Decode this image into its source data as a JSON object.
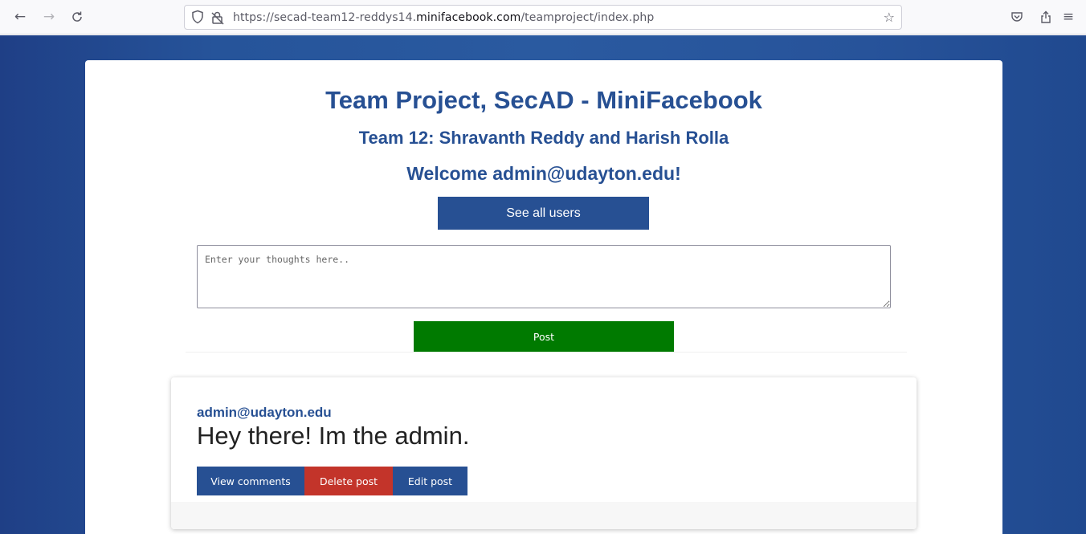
{
  "browser": {
    "back_icon": "←",
    "forward_icon": "→",
    "reload_icon": "C",
    "url_prefix": "https://secad-team12-reddys14.",
    "url_host": "minifacebook.com",
    "url_path": "/teamproject/index.php",
    "shield_icon": "◯",
    "lock_icon": "🔒",
    "star_icon": "☆",
    "pocket_icon": "⛉",
    "share_icon": "⇪",
    "menu_icon": "≡"
  },
  "header": {
    "title": "Team Project, SecAD - MiniFacebook",
    "subtitle": "Team 12: Shravanth Reddy and Harish Rolla",
    "welcome": "Welcome admin@udayton.edu!"
  },
  "actions": {
    "see_all_users": "See all users"
  },
  "composer": {
    "placeholder": "Enter your thoughts here..",
    "post_label": "Post"
  },
  "posts": [
    {
      "author": "admin@udayton.edu",
      "content": "Hey there! Im the admin.",
      "view_comments": "View comments",
      "delete_post": "Delete post",
      "edit_post": "Edit post"
    }
  ],
  "colors": {
    "brand_blue": "#275093",
    "post_green": "#007a00",
    "delete_red": "#c3342a"
  }
}
